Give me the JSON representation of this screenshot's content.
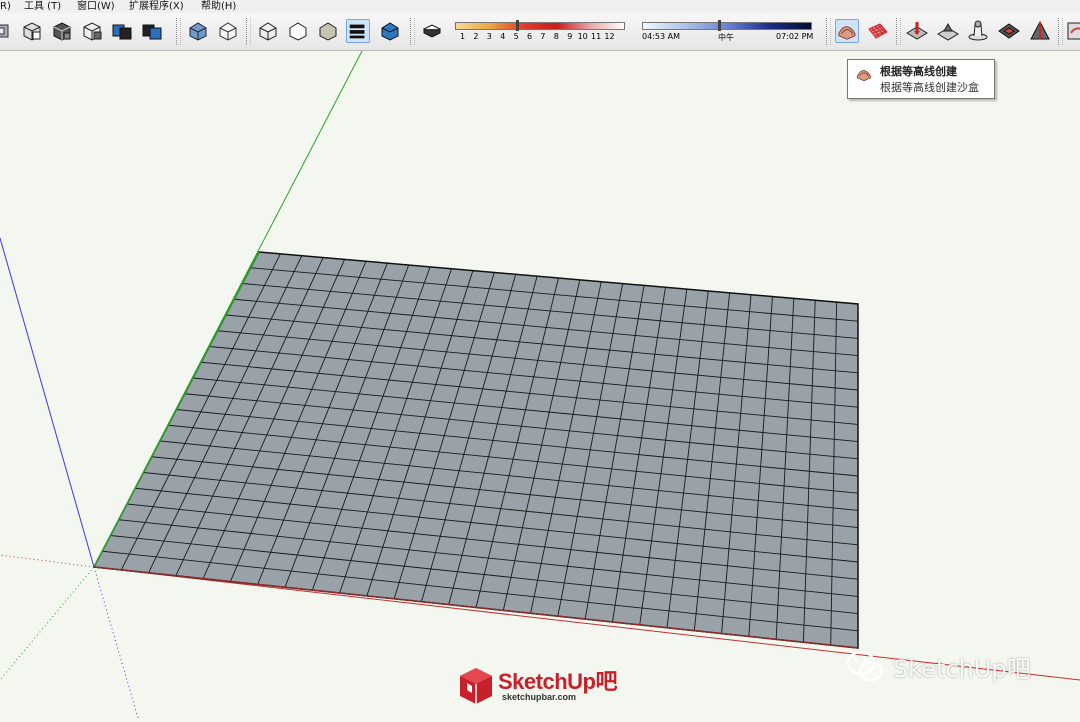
{
  "menu": {
    "items": [
      "R)",
      "工具 (T)",
      "窗口(W)",
      "扩展程序(X)",
      "帮助(H)"
    ]
  },
  "toolbar": {
    "icons": [
      "camera-icon",
      "group-icon",
      "component-icon",
      "section-icon",
      "layer-icon",
      "solid-icon",
      "xray-icon",
      "wireframe-icon",
      "hidden-line-icon",
      "shaded-icon",
      "shaded-texture-icon",
      "monochrome-icon",
      "shadow-toggle-icon",
      "from-contours-icon",
      "from-scratch-icon",
      "smoove-icon",
      "stamp-icon",
      "drape-icon",
      "add-detail-icon",
      "flip-edge-icon",
      "extra-icon"
    ],
    "month_ticks": [
      "1",
      "2",
      "3",
      "4",
      "5",
      "6",
      "7",
      "8",
      "9",
      "10",
      "11",
      "12"
    ],
    "time_start": "04:53 AM",
    "time_mid": "中午",
    "time_end": "07:02 PM",
    "date_month": 5,
    "time_fraction": 0.45
  },
  "tooltip": {
    "title": "根据等高线创建",
    "description": "根据等高线创建沙盒"
  },
  "watermark": {
    "brand": "SketchUp吧",
    "logo_text": "SketchUp吧",
    "logo_url": "sketchupbar.com"
  },
  "colors": {
    "canvas_bg": "#f3f7ef",
    "grid_fill": "#98a2a8",
    "axis_green": "#2aa12a",
    "axis_blue": "#3a3ad0",
    "axis_red": "#c03030",
    "brand_red": "#c8202b"
  },
  "grid": {
    "rows": 20,
    "cols": 28
  }
}
